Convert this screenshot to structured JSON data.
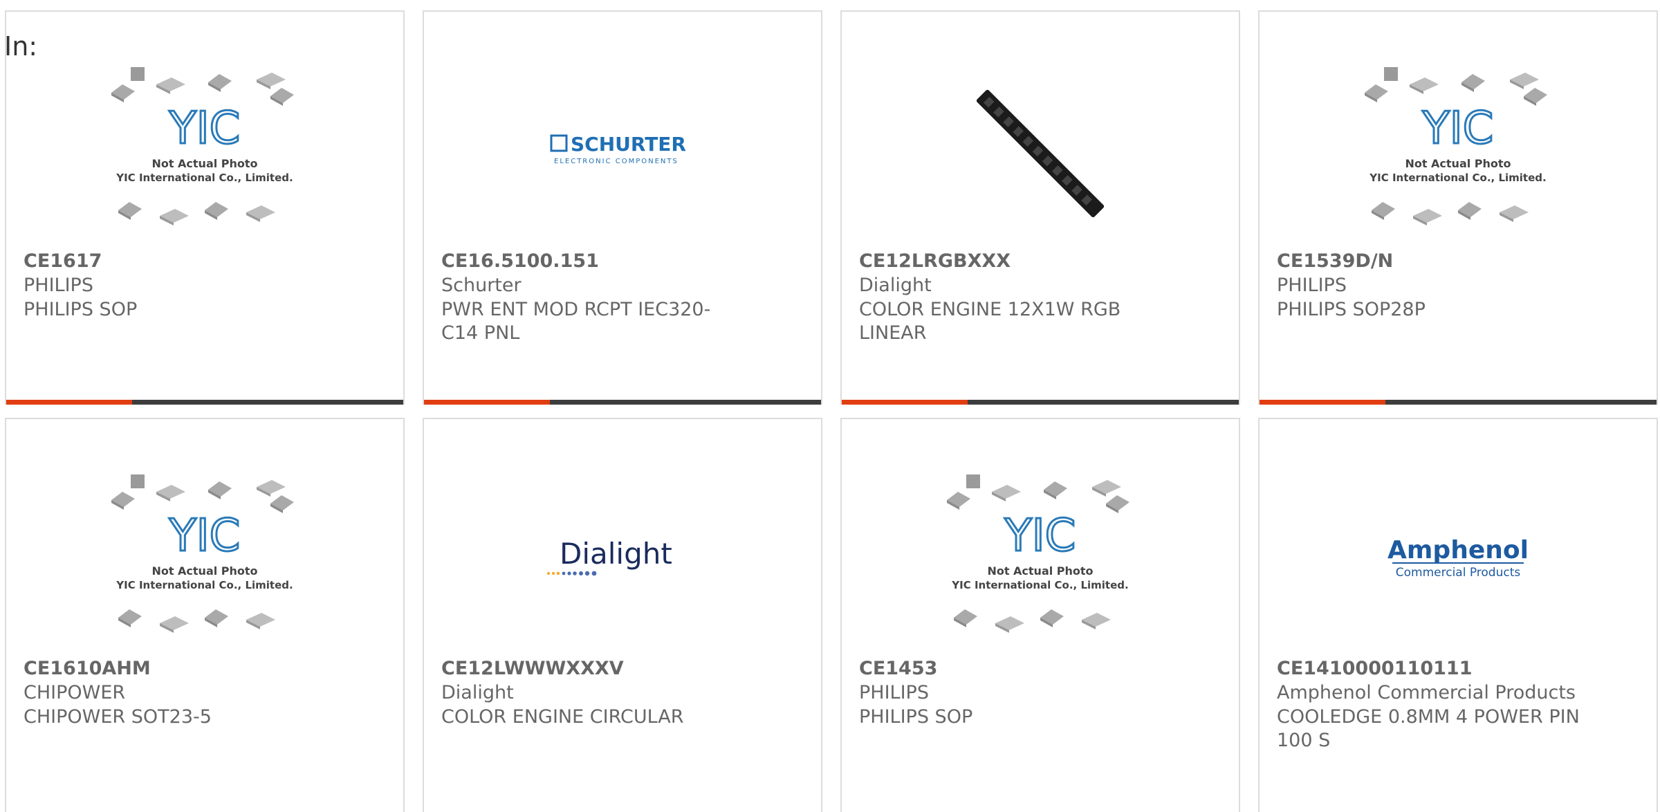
{
  "page": {
    "in_label": "In:"
  },
  "placeholder": {
    "line1": "Not Actual Photo",
    "line2": "YIC International Co., Limited.",
    "logo": "YIC"
  },
  "logos": {
    "schurter": {
      "brand": "SCHURTER",
      "sub": "ELECTRONIC COMPONENTS",
      "color": "#1f6fb4"
    },
    "dialight": {
      "brand": "Dialight",
      "color": "#1b2b5e"
    },
    "amphenol": {
      "brand": "Amphenol",
      "sub": "Commercial Products",
      "color": "#1d5aa0"
    }
  },
  "colors": {
    "accent": "#e03e12",
    "bar": "#3d3d3d"
  },
  "cards": [
    {
      "part": "CE1617",
      "maker": "PHILIPS",
      "desc": "PHILIPS SOP",
      "image": "yic-placeholder"
    },
    {
      "part": "CE16.5100.151",
      "maker": "Schurter",
      "desc": "PWR ENT MOD RCPT IEC320-C14 PNL",
      "image": "schurter-logo"
    },
    {
      "part": "CE12LRGBXXX",
      "maker": "Dialight",
      "desc": "COLOR ENGINE 12X1W RGB LINEAR",
      "image": "led-strip-photo"
    },
    {
      "part": "CE1539D/N",
      "maker": "PHILIPS",
      "desc": "PHILIPS SOP28P",
      "image": "yic-placeholder"
    },
    {
      "part": "CE1610AHM",
      "maker": "CHIPOWER",
      "desc": "CHIPOWER SOT23-5",
      "image": "yic-placeholder"
    },
    {
      "part": "CE12LWWWXXXV",
      "maker": "Dialight",
      "desc": "COLOR ENGINE CIRCULAR",
      "image": "dialight-logo"
    },
    {
      "part": "CE1453",
      "maker": "PHILIPS",
      "desc": "PHILIPS SOP",
      "image": "yic-placeholder"
    },
    {
      "part": "CE1410000110111",
      "maker": "Amphenol Commercial Products",
      "desc": "COOLEDGE 0.8MM 4 POWER PIN 100 S",
      "image": "amphenol-logo"
    }
  ]
}
